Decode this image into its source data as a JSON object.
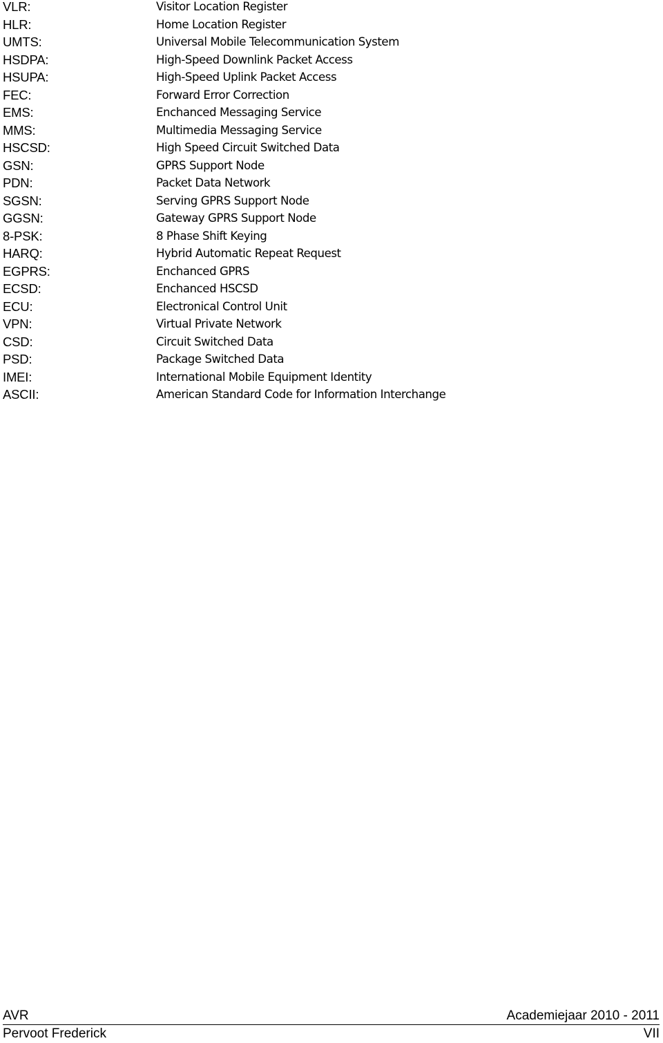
{
  "glossary": {
    "entries": [
      {
        "abbr": "VLR:",
        "definition": "Visitor Location Register"
      },
      {
        "abbr": "HLR:",
        "definition": "Home Location Register"
      },
      {
        "abbr": "UMTS:",
        "definition": "Universal Mobile Telecommunication System"
      },
      {
        "abbr": "HSDPA:",
        "definition": "High-Speed Downlink Packet Access"
      },
      {
        "abbr": "HSUPA:",
        "definition": "High-Speed Uplink Packet Access"
      },
      {
        "abbr": "FEC:",
        "definition": "Forward Error Correction"
      },
      {
        "abbr": "EMS:",
        "definition": "Enchanced Messaging Service"
      },
      {
        "abbr": "MMS:",
        "definition": "Multimedia Messaging Service"
      },
      {
        "abbr": "HSCSD:",
        "definition": "High Speed Circuit Switched Data"
      },
      {
        "abbr": "GSN:",
        "definition": "GPRS Support Node"
      },
      {
        "abbr": "PDN:",
        "definition": "Packet Data Network"
      },
      {
        "abbr": "SGSN:",
        "definition": "Serving GPRS Support Node"
      },
      {
        "abbr": "GGSN:",
        "definition": "Gateway GPRS Support Node"
      },
      {
        "abbr": "8-PSK:",
        "definition": "8 Phase Shift Keying"
      },
      {
        "abbr": "HARQ:",
        "definition": "Hybrid Automatic Repeat Request"
      },
      {
        "abbr": "EGPRS:",
        "definition": "Enchanced GPRS"
      },
      {
        "abbr": "ECSD:",
        "definition": "Enchanced HSCSD"
      },
      {
        "abbr": "ECU:",
        "definition": "Electronical Control Unit"
      },
      {
        "abbr": "VPN:",
        "definition": "Virtual Private Network"
      },
      {
        "abbr": "CSD:",
        "definition": "Circuit Switched Data"
      },
      {
        "abbr": "PSD:",
        "definition": "Package Switched Data"
      },
      {
        "abbr": "IMEI:",
        "definition": "International Mobile Equipment Identity"
      },
      {
        "abbr": "ASCII:",
        "definition": "American Standard Code for Information Interchange"
      }
    ]
  },
  "footer": {
    "left_top": "AVR",
    "right_top": "Academiejaar 2010 - 2011",
    "left_bottom": "Pervoot Frederick",
    "page_number": "VII"
  }
}
